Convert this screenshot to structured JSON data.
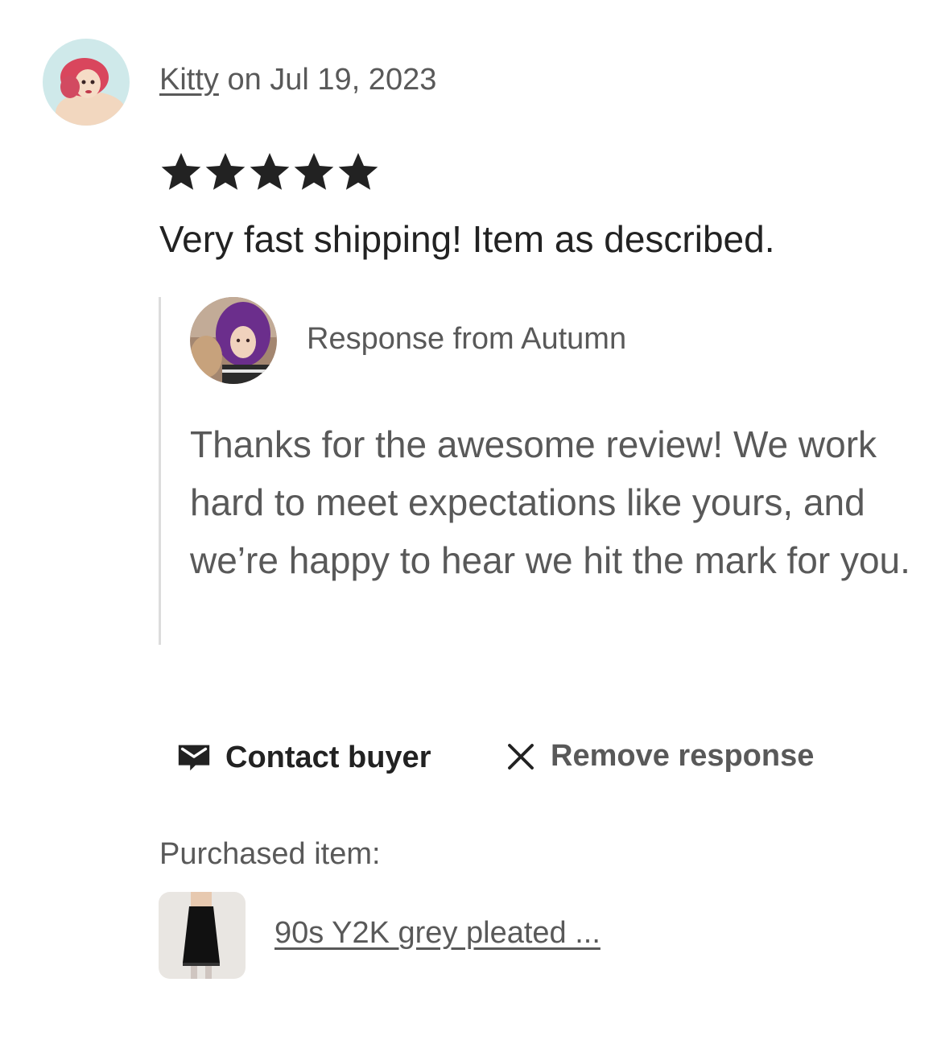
{
  "review": {
    "reviewer_name": "Kitty",
    "date_text": " on Jul 19, 2023",
    "rating": 5,
    "rating_max": 5,
    "text": "Very fast shipping! Item as described."
  },
  "response": {
    "from_text": "Response from Autumn",
    "text": "Thanks for the awesome review! We work hard to meet expectations like yours, and we’re happy to hear we hit the mark for you."
  },
  "actions": {
    "contact_label": "Contact buyer",
    "remove_label": "Remove response"
  },
  "purchased": {
    "label": "Purchased item:",
    "item_title": "90s Y2K grey pleated ..."
  },
  "colors": {
    "primary_text": "#222222",
    "secondary_text": "#595959",
    "divider": "#dcdcdc"
  }
}
